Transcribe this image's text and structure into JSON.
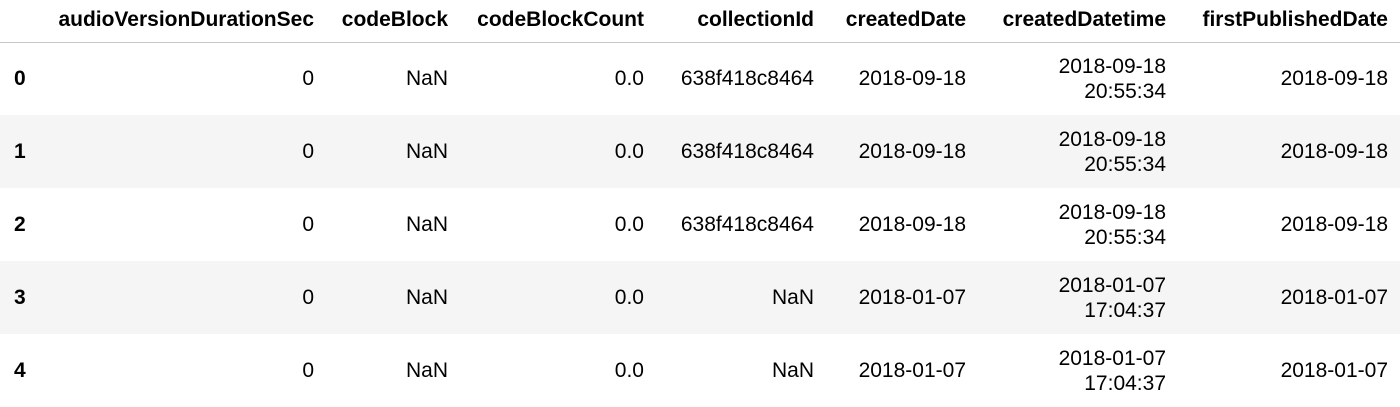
{
  "columns": [
    "audioVersionDurationSec",
    "codeBlock",
    "codeBlockCount",
    "collectionId",
    "createdDate",
    "createdDatetime",
    "firstPublishedDate"
  ],
  "rows": [
    {
      "index": "0",
      "audioVersionDurationSec": "0",
      "codeBlock": "NaN",
      "codeBlockCount": "0.0",
      "collectionId": "638f418c8464",
      "createdDate": "2018-09-18",
      "createdDatetime_date": "2018-09-18",
      "createdDatetime_time": "20:55:34",
      "firstPublishedDate": "2018-09-18"
    },
    {
      "index": "1",
      "audioVersionDurationSec": "0",
      "codeBlock": "NaN",
      "codeBlockCount": "0.0",
      "collectionId": "638f418c8464",
      "createdDate": "2018-09-18",
      "createdDatetime_date": "2018-09-18",
      "createdDatetime_time": "20:55:34",
      "firstPublishedDate": "2018-09-18"
    },
    {
      "index": "2",
      "audioVersionDurationSec": "0",
      "codeBlock": "NaN",
      "codeBlockCount": "0.0",
      "collectionId": "638f418c8464",
      "createdDate": "2018-09-18",
      "createdDatetime_date": "2018-09-18",
      "createdDatetime_time": "20:55:34",
      "firstPublishedDate": "2018-09-18"
    },
    {
      "index": "3",
      "audioVersionDurationSec": "0",
      "codeBlock": "NaN",
      "codeBlockCount": "0.0",
      "collectionId": "NaN",
      "createdDate": "2018-01-07",
      "createdDatetime_date": "2018-01-07",
      "createdDatetime_time": "17:04:37",
      "firstPublishedDate": "2018-01-07"
    },
    {
      "index": "4",
      "audioVersionDurationSec": "0",
      "codeBlock": "NaN",
      "codeBlockCount": "0.0",
      "collectionId": "NaN",
      "createdDate": "2018-01-07",
      "createdDatetime_date": "2018-01-07",
      "createdDatetime_time": "17:04:37",
      "firstPublishedDate": "2018-01-07"
    }
  ]
}
